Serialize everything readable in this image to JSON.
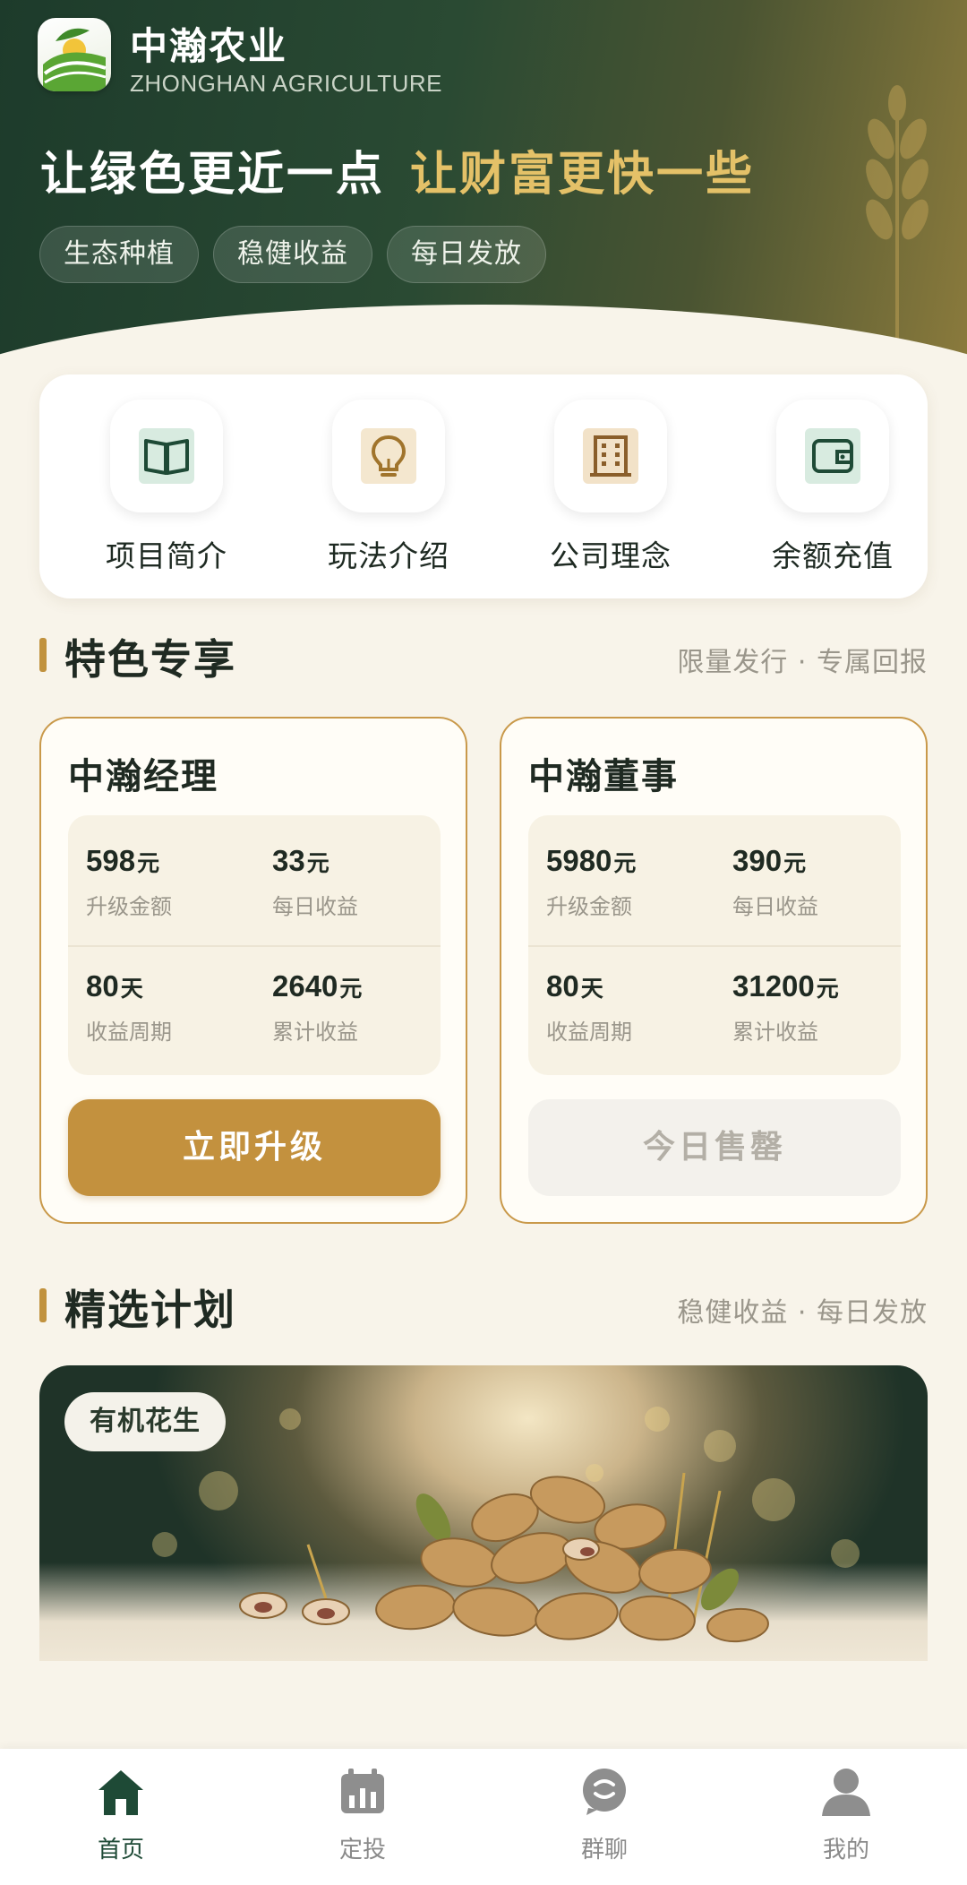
{
  "header": {
    "brand_cn": "中瀚农业",
    "brand_en": "ZHONGHAN AGRICULTURE",
    "slogan_part1": "让绿色更近一点",
    "slogan_part2": "让财富更快一些",
    "tags": [
      "生态种植",
      "稳健收益",
      "每日发放"
    ]
  },
  "menu": [
    {
      "label": "项目简介",
      "icon": "book-icon"
    },
    {
      "label": "玩法介绍",
      "icon": "lightbulb-icon"
    },
    {
      "label": "公司理念",
      "icon": "building-icon"
    },
    {
      "label": "余额充值",
      "icon": "wallet-icon"
    }
  ],
  "featured": {
    "title": "特色专享",
    "subtitle": "限量发行 · 专属回报",
    "plans": [
      {
        "name": "中瀚经理",
        "upgrade_amount": "598",
        "upgrade_unit": "元",
        "upgrade_label": "升级金额",
        "daily": "33",
        "daily_unit": "元",
        "daily_label": "每日收益",
        "period": "80",
        "period_unit": "天",
        "period_label": "收益周期",
        "total": "2640",
        "total_unit": "元",
        "total_label": "累计收益",
        "button": "立即升级",
        "button_state": "active"
      },
      {
        "name": "中瀚董事",
        "upgrade_amount": "5980",
        "upgrade_unit": "元",
        "upgrade_label": "升级金额",
        "daily": "390",
        "daily_unit": "元",
        "daily_label": "每日收益",
        "period": "80",
        "period_unit": "天",
        "period_label": "收益周期",
        "total": "31200",
        "total_unit": "元",
        "total_label": "累计收益",
        "button": "今日售罄",
        "button_state": "disabled"
      }
    ]
  },
  "selected": {
    "title": "精选计划",
    "subtitle": "稳健收益 · 每日发放",
    "banner_tag": "有机花生"
  },
  "tabbar": [
    {
      "label": "首页",
      "icon": "home-icon",
      "active": true
    },
    {
      "label": "定投",
      "icon": "calendar-chart-icon",
      "active": false
    },
    {
      "label": "群聊",
      "icon": "chat-icon",
      "active": false
    },
    {
      "label": "我的",
      "icon": "user-icon",
      "active": false
    }
  ],
  "colors": {
    "primary_green": "#1e4a36",
    "gold": "#c3913e",
    "background": "#f8f4ea"
  }
}
